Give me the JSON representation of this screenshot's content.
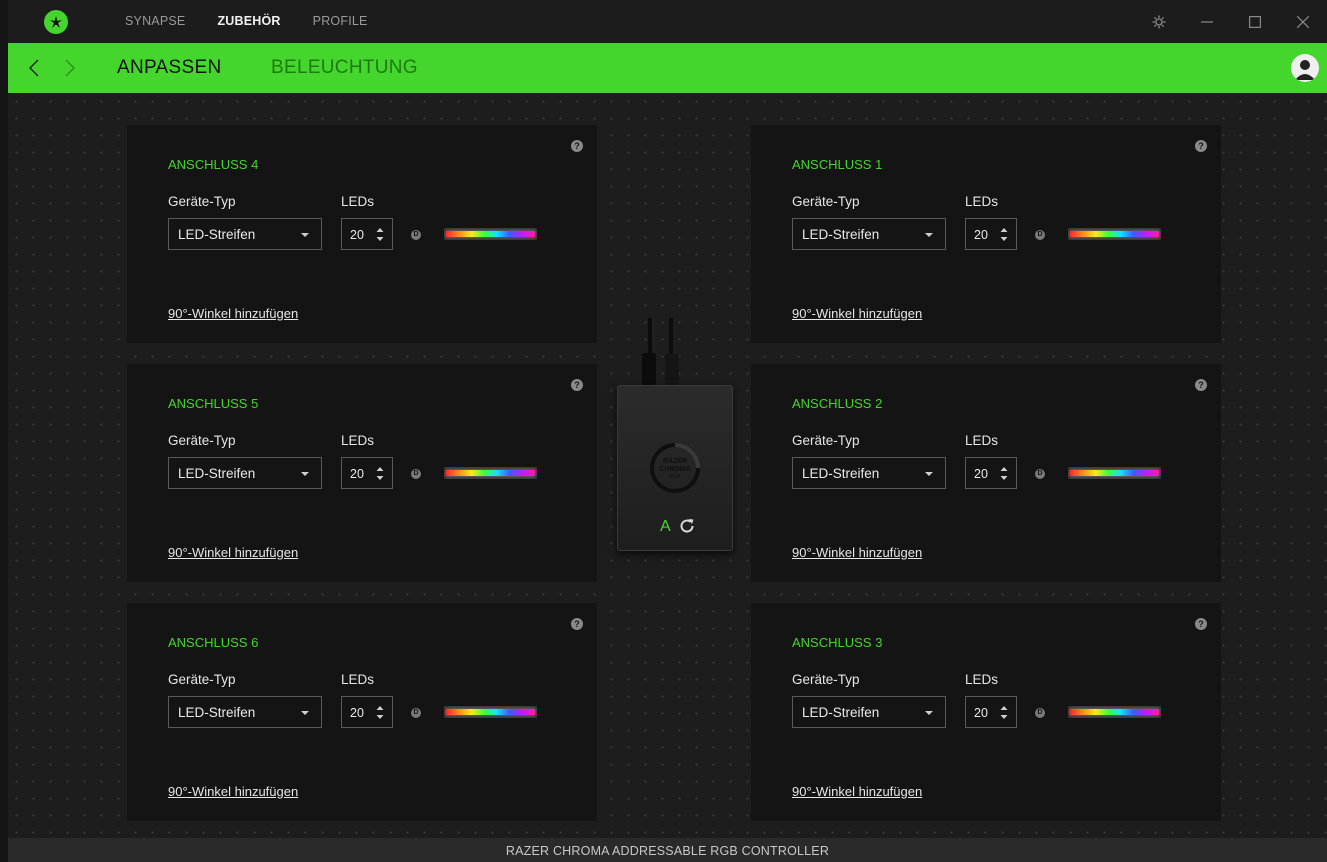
{
  "titlebar": {
    "nav": [
      "SYNAPSE",
      "ZUBEHÖR",
      "PROFILE"
    ],
    "active_nav": "ZUBEHÖR"
  },
  "subheader": {
    "tabs": [
      "ANPASSEN",
      "BELEUCHTUNG"
    ],
    "active_tab": "ANPASSEN"
  },
  "panels": [
    {
      "title": "ANSCHLUSS 4",
      "type_label": "Geräte-Typ",
      "leds_label": "LEDs",
      "device_type": "LED-Streifen",
      "leds": "20",
      "badge": "D",
      "help": "?",
      "link": "90°-Winkel hinzufügen"
    },
    {
      "title": "ANSCHLUSS 1",
      "type_label": "Geräte-Typ",
      "leds_label": "LEDs",
      "device_type": "LED-Streifen",
      "leds": "20",
      "badge": "D",
      "help": "?",
      "link": "90°-Winkel hinzufügen"
    },
    {
      "title": "ANSCHLUSS 5",
      "type_label": "Geräte-Typ",
      "leds_label": "LEDs",
      "device_type": "LED-Streifen",
      "leds": "20",
      "badge": "D",
      "help": "?",
      "link": "90°-Winkel hinzufügen"
    },
    {
      "title": "ANSCHLUSS 2",
      "type_label": "Geräte-Typ",
      "leds_label": "LEDs",
      "device_type": "LED-Streifen",
      "leds": "20",
      "badge": "D",
      "help": "?",
      "link": "90°-Winkel hinzufügen"
    },
    {
      "title": "ANSCHLUSS 6",
      "type_label": "Geräte-Typ",
      "leds_label": "LEDs",
      "device_type": "LED-Streifen",
      "leds": "20",
      "badge": "D",
      "help": "?",
      "link": "90°-Winkel hinzufügen"
    },
    {
      "title": "ANSCHLUSS 3",
      "type_label": "Geräte-Typ",
      "leds_label": "LEDs",
      "device_type": "LED-Streifen",
      "leds": "20",
      "badge": "D",
      "help": "?",
      "link": "90°-Winkel hinzufügen"
    }
  ],
  "device": {
    "logo_text": [
      "RAZER",
      "CHROMA",
      "RGB"
    ],
    "mode_label": "A"
  },
  "footer": {
    "device_name": "RAZER CHROMA ADDRESSABLE RGB CONTROLLER"
  },
  "colors": {
    "accent": "#44d62c",
    "background": "#1d1d1d",
    "panel": "#141414"
  },
  "icons": [
    "razer-logo-icon",
    "settings-icon",
    "minimize-icon",
    "maximize-icon",
    "close-icon",
    "back-arrow-icon",
    "forward-arrow-icon",
    "user-icon",
    "help-icon",
    "refresh-icon"
  ]
}
